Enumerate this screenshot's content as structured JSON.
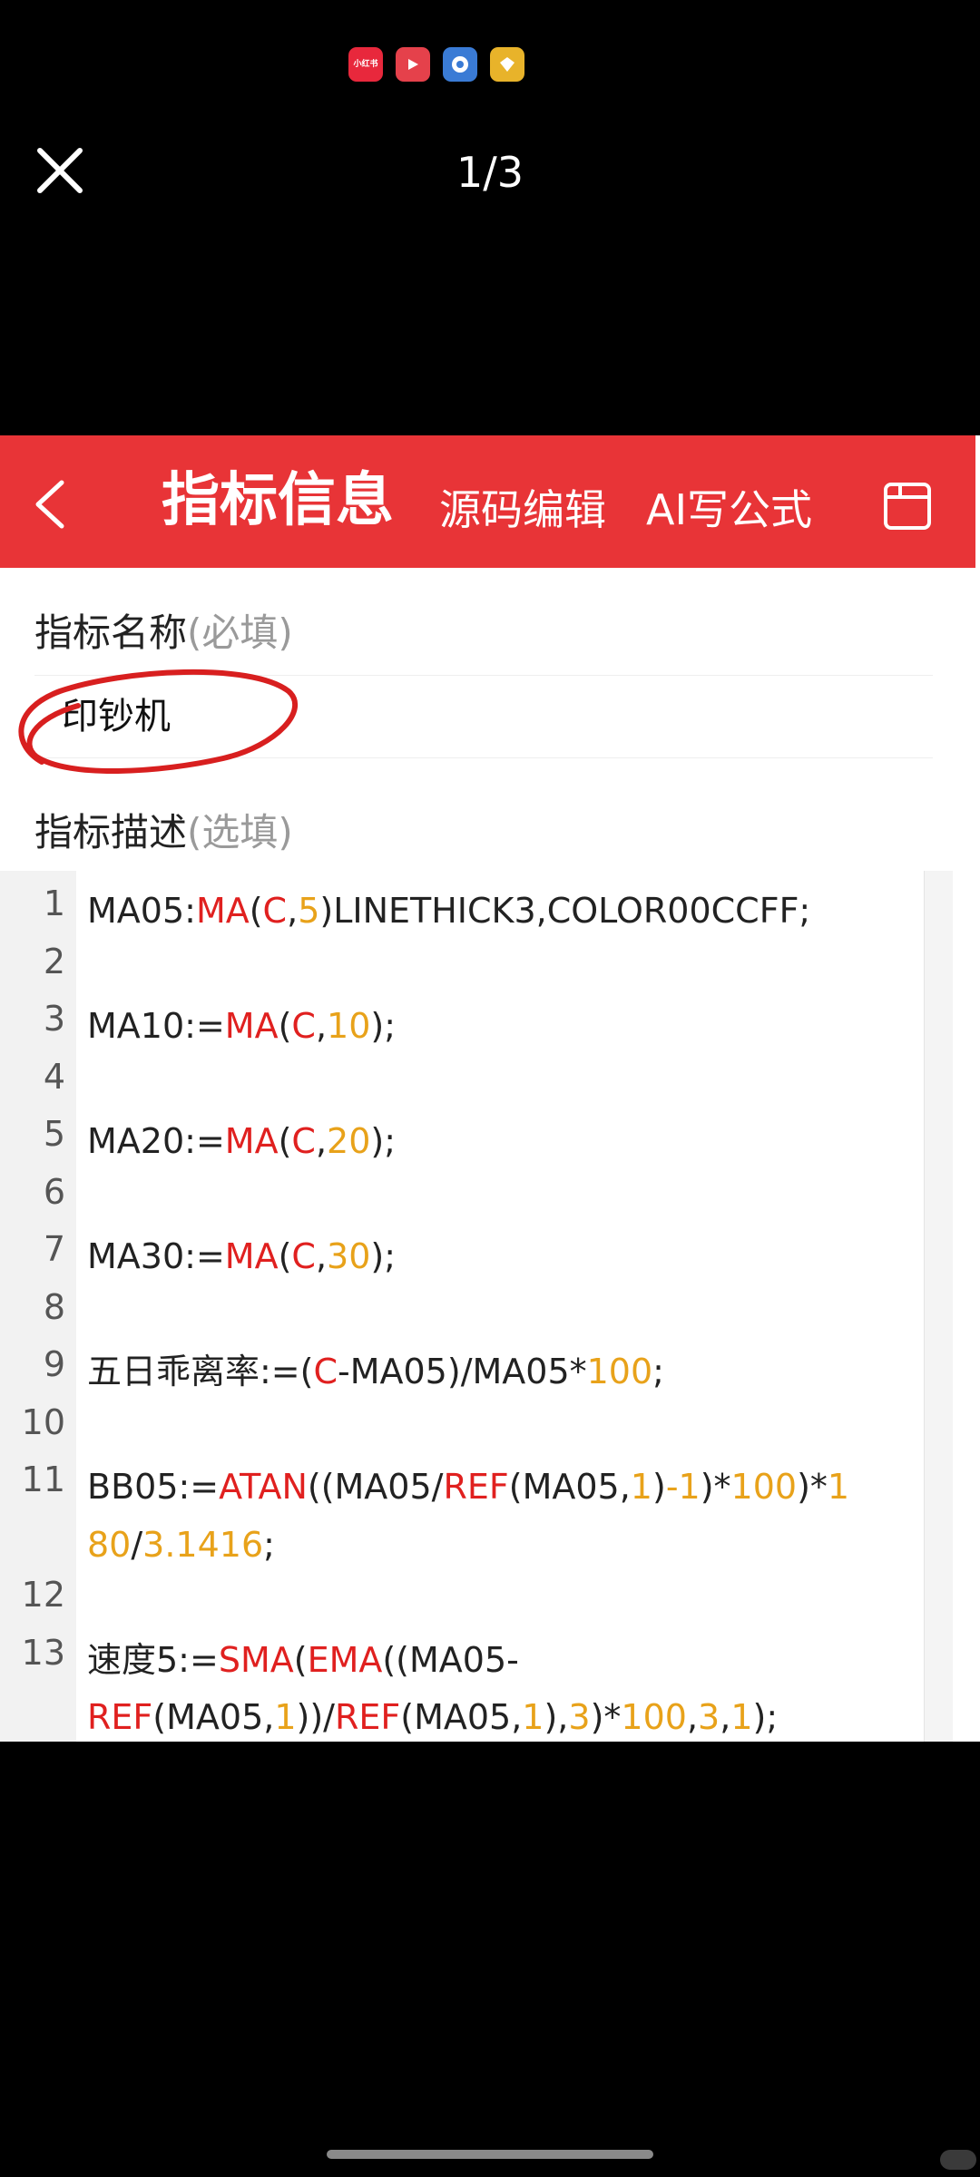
{
  "viewer": {
    "status_icons": [
      {
        "name": "xiaohongshu-icon",
        "label": "小红书",
        "color": "#e8283c"
      },
      {
        "name": "video-icon",
        "label": "",
        "color": "#e5414b"
      },
      {
        "name": "browser-icon",
        "label": "",
        "color": "#3a7bd5"
      },
      {
        "name": "gem-icon",
        "label": "",
        "color": "#e8b32a"
      }
    ],
    "page_counter": "1/3"
  },
  "app": {
    "header_title": "指标信息",
    "source_edit": "源码编辑",
    "ai_formula": "AI写公式",
    "header_color": "#e83437"
  },
  "form": {
    "name_label": "指标名称",
    "name_hint": "(必填)",
    "name_value": "印钞机",
    "desc_label": "指标描述",
    "desc_hint": "(选填)"
  },
  "editor": {
    "line_numbers": [
      "1",
      "2",
      "3",
      "4",
      "5",
      "6",
      "7",
      "8",
      "9",
      "10",
      "11",
      "12",
      "13"
    ],
    "lines": [
      [
        [
          "MA05:",
          ""
        ],
        [
          "MA",
          "r"
        ],
        [
          "(",
          ""
        ],
        [
          "C",
          "r"
        ],
        [
          ",",
          ""
        ],
        [
          "5",
          "o"
        ],
        [
          ")LINETHICK3,COLOR00CCFF;",
          ""
        ]
      ],
      [],
      [
        [
          "MA10:=",
          ""
        ],
        [
          "MA",
          "r"
        ],
        [
          "(",
          ""
        ],
        [
          "C",
          "r"
        ],
        [
          ",",
          ""
        ],
        [
          "10",
          "o"
        ],
        [
          ");",
          ""
        ]
      ],
      [],
      [
        [
          "MA20:=",
          ""
        ],
        [
          "MA",
          "r"
        ],
        [
          "(",
          ""
        ],
        [
          "C",
          "r"
        ],
        [
          ",",
          ""
        ],
        [
          "20",
          "o"
        ],
        [
          ");",
          ""
        ]
      ],
      [],
      [
        [
          "MA30:=",
          ""
        ],
        [
          "MA",
          "r"
        ],
        [
          "(",
          ""
        ],
        [
          "C",
          "r"
        ],
        [
          ",",
          ""
        ],
        [
          "30",
          "o"
        ],
        [
          ");",
          ""
        ]
      ],
      [],
      [
        [
          "五日乖离率:=(",
          ""
        ],
        [
          "C",
          "r"
        ],
        [
          "-MA05)/MA05*",
          ""
        ],
        [
          "100",
          "o"
        ],
        [
          ";",
          ""
        ]
      ],
      [],
      [
        [
          "BB05:=",
          ""
        ],
        [
          "ATAN",
          "r"
        ],
        [
          "((MA05/",
          ""
        ],
        [
          "REF",
          "r"
        ],
        [
          "(MA05,",
          ""
        ],
        [
          "1",
          "o"
        ],
        [
          ")",
          ""
        ],
        [
          "-1",
          "o"
        ],
        [
          ")*",
          ""
        ],
        [
          "100",
          "o"
        ],
        [
          ")*",
          ""
        ],
        [
          "1",
          "o"
        ]
      ],
      [
        [
          "80",
          "o"
        ],
        [
          "/",
          ""
        ],
        [
          "3.1416",
          "o"
        ],
        [
          ";",
          ""
        ]
      ],
      [],
      [
        [
          "速度5:=",
          ""
        ],
        [
          "SMA",
          "r"
        ],
        [
          "(",
          ""
        ],
        [
          "EMA",
          "r"
        ],
        [
          "((MA05-",
          ""
        ]
      ],
      [
        [
          "REF",
          "r"
        ],
        [
          "(MA05,",
          ""
        ],
        [
          "1",
          "o"
        ],
        [
          "))/",
          ""
        ],
        [
          "REF",
          "r"
        ],
        [
          "(MA05,",
          ""
        ],
        [
          "1",
          "o"
        ],
        [
          "),",
          ""
        ],
        [
          "3",
          "o"
        ],
        [
          ")*",
          ""
        ],
        [
          "100",
          "o"
        ],
        [
          ",",
          ""
        ],
        [
          "3",
          "o"
        ],
        [
          ",",
          ""
        ],
        [
          "1",
          "o"
        ],
        [
          ");",
          ""
        ]
      ]
    ]
  }
}
